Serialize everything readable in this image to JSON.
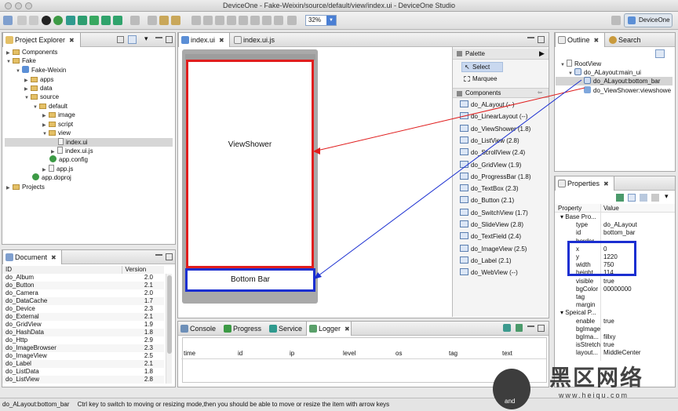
{
  "window": {
    "title": "DeviceOne - Fake-Weixin/source/default/view/index.ui - DeviceOne Studio"
  },
  "toolbar": {
    "zoom": "32%",
    "perspective": "DeviceOne"
  },
  "project_explorer": {
    "tab": "Project Explorer",
    "items": [
      {
        "label": "Components",
        "indent": 0
      },
      {
        "label": "Fake",
        "indent": 0
      },
      {
        "label": "Fake-Weixin",
        "indent": 1
      },
      {
        "label": "apps",
        "indent": 2
      },
      {
        "label": "data",
        "indent": 2
      },
      {
        "label": "source",
        "indent": 2
      },
      {
        "label": "default",
        "indent": 3
      },
      {
        "label": "image",
        "indent": 4
      },
      {
        "label": "script",
        "indent": 4
      },
      {
        "label": "view",
        "indent": 4
      },
      {
        "label": "index.ui",
        "indent": 5
      },
      {
        "label": "index.ui.js",
        "indent": 5
      },
      {
        "label": "app.config",
        "indent": 4
      },
      {
        "label": "app.js",
        "indent": 4
      },
      {
        "label": "app.doproj",
        "indent": 2
      },
      {
        "label": "Projects",
        "indent": 0
      }
    ]
  },
  "document_panel": {
    "tab": "Document",
    "headers": [
      "ID",
      "Version"
    ],
    "rows": [
      [
        "do_Album",
        "2.0"
      ],
      [
        "do_Button",
        "2.1"
      ],
      [
        "do_Camera",
        "2.0"
      ],
      [
        "do_DataCache",
        "1.7"
      ],
      [
        "do_Device",
        "2.3"
      ],
      [
        "do_External",
        "2.1"
      ],
      [
        "do_GridView",
        "1.9"
      ],
      [
        "do_HashData",
        "1.8"
      ],
      [
        "do_Http",
        "2.9"
      ],
      [
        "do_ImageBrowser",
        "2.3"
      ],
      [
        "do_ImageView",
        "2.5"
      ],
      [
        "do_Label",
        "2.1"
      ],
      [
        "do_ListData",
        "1.8"
      ],
      [
        "do_ListView",
        "2.8"
      ]
    ]
  },
  "editor": {
    "tabs": [
      "index.ui",
      "index.ui.js"
    ],
    "viewshower_label": "ViewShower",
    "bottombar_label": "Bottom Bar"
  },
  "palette": {
    "title": "Palette",
    "tools": [
      "Select",
      "Marquee"
    ],
    "components_title": "Components",
    "components": [
      "do_ALayout (--)",
      "do_LinearLayout (--)",
      "do_ViewShower (1.8)",
      "do_ListView (2.8)",
      "do_ScrollView (2.4)",
      "do_GridView (1.9)",
      "do_ProgressBar (1.8)",
      "do_TextBox (2.3)",
      "do_Button (2.1)",
      "do_SwitchView (1.7)",
      "do_SlideView (2.8)",
      "do_TextField (2.4)",
      "do_ImageView (2.5)",
      "do_Label (2.1)",
      "do_WebView (--)"
    ]
  },
  "console_panel": {
    "tabs": [
      "Console",
      "Progress",
      "Service",
      "Logger"
    ],
    "columns": [
      "time",
      "id",
      "ip",
      "level",
      "os",
      "tag",
      "text"
    ]
  },
  "outline": {
    "tabs": [
      "Outline",
      "Search"
    ],
    "items": [
      "RootView",
      "do_ALayout:main_ui",
      "do_ALayout:bottom_bar",
      "do_ViewShower:viewshowe"
    ]
  },
  "properties": {
    "tab": "Properties",
    "headers": [
      "Property",
      "Value"
    ],
    "rows": [
      {
        "k": "▾ Base Pro...",
        "v": "",
        "group": true
      },
      {
        "k": "type",
        "v": "do_ALayout"
      },
      {
        "k": "id",
        "v": "bottom_bar"
      },
      {
        "k": "border",
        "v": ""
      },
      {
        "k": "x",
        "v": "0"
      },
      {
        "k": "y",
        "v": "1220"
      },
      {
        "k": "width",
        "v": "750"
      },
      {
        "k": "height",
        "v": "114"
      },
      {
        "k": "visible",
        "v": "true"
      },
      {
        "k": "bgColor",
        "v": "00000000"
      },
      {
        "k": "tag",
        "v": ""
      },
      {
        "k": "margin",
        "v": ""
      },
      {
        "k": "▾ Speical P...",
        "v": "",
        "group": true
      },
      {
        "k": "enable",
        "v": "true"
      },
      {
        "k": "bgImage",
        "v": ""
      },
      {
        "k": "bgIma...",
        "v": "fillxy"
      },
      {
        "k": "isStretch",
        "v": "true"
      },
      {
        "k": "layout...",
        "v": "MiddleCenter"
      }
    ]
  },
  "statusbar": {
    "selection": "do_ALayout:bottom_bar",
    "hint": "Ctrl key to switch to moving or resizing mode,then you should be able to move or resize the item with arrow keys"
  },
  "watermark": {
    "text": "黑区网络",
    "url": "www.heiqu.com",
    "badge": "and"
  },
  "colors": {
    "highlight_red": "#e01e1e",
    "highlight_blue": "#1b2fd1",
    "selection": "#c9d8ef"
  }
}
